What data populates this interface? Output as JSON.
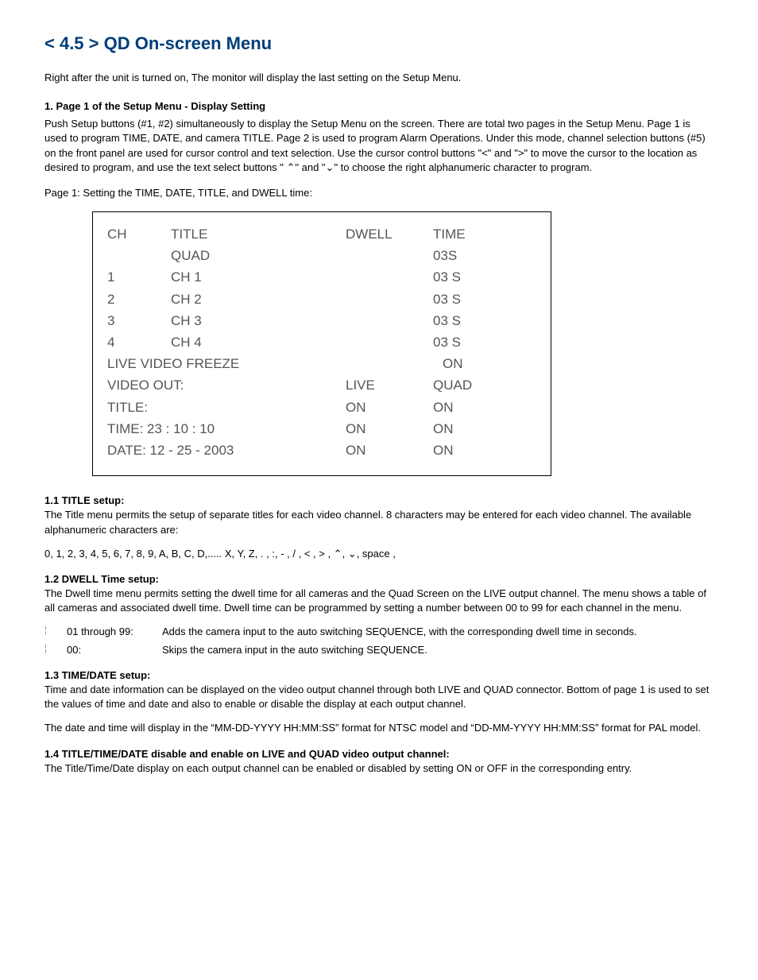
{
  "title": "< 4.5 > QD  On-screen Menu",
  "intro": "Right after the unit is turned on, The monitor will display the last setting on the Setup Menu.",
  "section1_head": "1.  Page 1 of the Setup Menu - Display Setting",
  "section1_body": "Push Setup buttons (#1, #2) simultaneously to display the Setup Menu on the screen. There are total two pages in the Setup Menu. Page 1 is used to program TIME, DATE, and camera TITLE. Page 2 is used to program Alarm Operations. Under this mode, channel selection buttons (#5) on the front panel are used for cursor control and text selection. Use the cursor control buttons \"<\" and \">\" to move the cursor to the location as desired to program, and use the text select buttons \" ⌃\" and \"⌄\" to choose the right alphanumeric character to program.",
  "page1_caption": "Page 1: Setting the TIME, DATE, TITLE, and DWELL time:",
  "table": {
    "head": {
      "ch": "CH",
      "title": "TITLE",
      "dwell": "DWELL",
      "time": "TIME"
    },
    "quad_row": {
      "ch": "",
      "title": "QUAD",
      "live": "",
      "quad": "03S"
    },
    "channels": [
      {
        "ch": "1",
        "title": "CH 1",
        "live": "",
        "quad": "03 S"
      },
      {
        "ch": "2",
        "title": "CH 2",
        "live": "",
        "quad": "03 S"
      },
      {
        "ch": "3",
        "title": "CH 3",
        "live": "",
        "quad": "03 S"
      },
      {
        "ch": "4",
        "title": "CH 4",
        "live": "",
        "quad": "03 S"
      }
    ],
    "rows": [
      {
        "label": "LIVE VIDEO FREEZE",
        "live": "",
        "quad": "ON"
      },
      {
        "label": "VIDEO OUT:",
        "live": "LIVE",
        "quad": "QUAD"
      },
      {
        "label": "TITLE:",
        "live": "ON",
        "quad": "ON"
      },
      {
        "label": "TIME: 23 : 10 : 10",
        "live": "ON",
        "quad": "ON"
      },
      {
        "label": "DATE: 12 - 25 - 2003",
        "live": "ON",
        "quad": "ON"
      }
    ]
  },
  "s11_head": "1.1  TITLE setup:",
  "s11_body": "The Title menu permits the setup of separate titles for each video channel. 8 characters may be entered for each video channel. The available alphanumeric characters are:",
  "s11_chars": "0, 1, 2, 3, 4, 5, 6, 7, 8, 9, A, B, C, D,..... X, Y, Z,  . ,   :, - , / , < , > , ⌃, ⌄, space ,",
  "s12_head": "1.2  DWELL Time setup:",
  "s12_body": "The Dwell time menu permits setting the dwell time for all cameras and  the Quad Screen on the LIVE output channel. The menu shows a table of all cameras and associated dwell time. Dwell time can be programmed by setting a number between 00 to 99 for each channel in the menu.",
  "s12_items": [
    {
      "key": "01 through 99:",
      "val": "Adds the camera input to the auto switching SEQUENCE, with the corresponding dwell time in seconds."
    },
    {
      "key": "00:",
      "val": "Skips the camera input in the auto switching SEQUENCE."
    }
  ],
  "s13_head": "1.3  TIME/DATE setup:",
  "s13_body1": "Time and date information can be displayed on the video output channel through both LIVE and QUAD connector. Bottom of page 1 is used to set the values of time and date and also to enable or disable the display at each output channel.",
  "s13_body2": "The date and time will display in the “MM-DD-YYYY HH:MM:SS” format for NTSC model and “DD-MM-YYYY HH:MM:SS” format for PAL model.",
  "s14_head": "1.4  TITLE/TIME/DATE disable and enable on LIVE and QUAD video output channel:",
  "s14_body": "The Title/Time/Date display on each output channel can be enabled or disabled by setting ON or OFF in the corresponding entry."
}
